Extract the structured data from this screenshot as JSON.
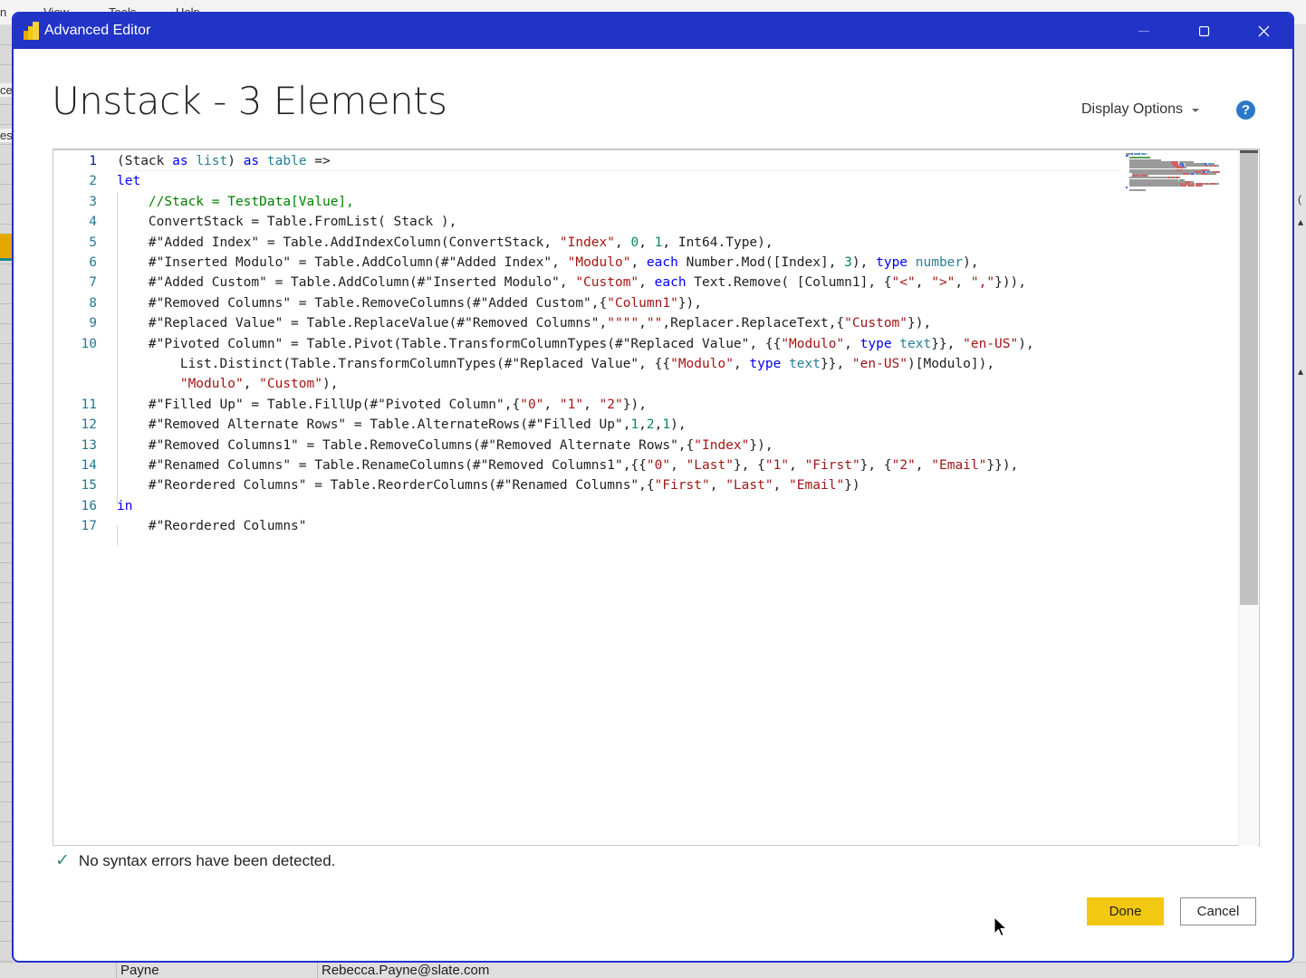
{
  "background_app": {
    "menu": [
      "n",
      "View",
      "Tools",
      "Help"
    ],
    "left_labels": [
      "ce",
      "es"
    ],
    "bottom_row": {
      "last_name": "Payne",
      "email": "Rebecca.Payne@slate.com"
    }
  },
  "window": {
    "title": "Advanced Editor",
    "app_icon": "power-bi-icon",
    "controls": {
      "minimize": "minimize-icon",
      "maximize": "maximize-icon",
      "close": "close-icon"
    }
  },
  "editor_header": {
    "query_name": "Unstack - 3 Elements",
    "display_options_label": "Display Options",
    "help_label": "?"
  },
  "colors": {
    "titlebar": "#2233c8",
    "done_button": "#f2c811",
    "keyword": "#0000ff",
    "type": "#267f99",
    "string": "#a31515",
    "number": "#098658",
    "comment": "#008000",
    "line_number": "#237893"
  },
  "code": {
    "lines": [
      {
        "n": "1",
        "tokens": [
          [
            "p",
            "(Stack "
          ],
          [
            "k",
            "as"
          ],
          [
            "p",
            " "
          ],
          [
            "t",
            "list"
          ],
          [
            "p",
            ") "
          ],
          [
            "k",
            "as"
          ],
          [
            "p",
            " "
          ],
          [
            "t",
            "table"
          ],
          [
            "p",
            " =>"
          ]
        ]
      },
      {
        "n": "2",
        "tokens": [
          [
            "k",
            "let"
          ]
        ]
      },
      {
        "n": "3",
        "tokens": [
          [
            "p",
            "    "
          ],
          [
            "c",
            "//Stack = TestData[Value],"
          ]
        ]
      },
      {
        "n": "4",
        "tokens": [
          [
            "p",
            "    ConvertStack = Table.FromList( Stack ),"
          ]
        ]
      },
      {
        "n": "5",
        "tokens": [
          [
            "p",
            "    #\"Added Index\" = Table.AddIndexColumn(ConvertStack, "
          ],
          [
            "s",
            "\"Index\""
          ],
          [
            "p",
            ", "
          ],
          [
            "d",
            "0"
          ],
          [
            "p",
            ", "
          ],
          [
            "d",
            "1"
          ],
          [
            "p",
            ", Int64.Type),"
          ]
        ]
      },
      {
        "n": "6",
        "tokens": [
          [
            "p",
            "    #\"Inserted Modulo\" = Table.AddColumn(#\"Added Index\", "
          ],
          [
            "s",
            "\"Modulo\""
          ],
          [
            "p",
            ", "
          ],
          [
            "k",
            "each"
          ],
          [
            "p",
            " Number.Mod([Index], "
          ],
          [
            "d",
            "3"
          ],
          [
            "p",
            "), "
          ],
          [
            "k",
            "type"
          ],
          [
            "p",
            " "
          ],
          [
            "t",
            "number"
          ],
          [
            "p",
            "),"
          ]
        ]
      },
      {
        "n": "7",
        "tokens": [
          [
            "p",
            "    #\"Added Custom\" = Table.AddColumn(#\"Inserted Modulo\", "
          ],
          [
            "s",
            "\"Custom\""
          ],
          [
            "p",
            ", "
          ],
          [
            "k",
            "each"
          ],
          [
            "p",
            " Text.Remove( [Column1], {"
          ],
          [
            "s",
            "\"<\""
          ],
          [
            "p",
            ", "
          ],
          [
            "s",
            "\">\""
          ],
          [
            "p",
            ", "
          ],
          [
            "s",
            "\",\""
          ],
          [
            "p",
            "})),"
          ]
        ]
      },
      {
        "n": "8",
        "tokens": [
          [
            "p",
            "    #\"Removed Columns\" = Table.RemoveColumns(#\"Added Custom\",{"
          ],
          [
            "s",
            "\"Column1\""
          ],
          [
            "p",
            "}),"
          ]
        ]
      },
      {
        "n": "9",
        "tokens": [
          [
            "p",
            "    #\"Replaced Value\" = Table.ReplaceValue(#\"Removed Columns\","
          ],
          [
            "s",
            "\"\"\"\""
          ],
          [
            "p",
            ","
          ],
          [
            "s",
            "\"\""
          ],
          [
            "p",
            ",Replacer.ReplaceText,{"
          ],
          [
            "s",
            "\"Custom\""
          ],
          [
            "p",
            "}),"
          ]
        ]
      },
      {
        "n": "10",
        "tokens": [
          [
            "p",
            "    #\"Pivoted Column\" = Table.Pivot(Table.TransformColumnTypes(#\"Replaced Value\", {{"
          ],
          [
            "s",
            "\"Modulo\""
          ],
          [
            "p",
            ", "
          ],
          [
            "k",
            "type"
          ],
          [
            "p",
            " "
          ],
          [
            "t",
            "text"
          ],
          [
            "p",
            "}}, "
          ],
          [
            "s",
            "\"en-US\""
          ],
          [
            "p",
            "),"
          ]
        ]
      },
      {
        "n": "",
        "tokens": [
          [
            "p",
            "        List.Distinct(Table.TransformColumnTypes(#\"Replaced Value\", {{"
          ],
          [
            "s",
            "\"Modulo\""
          ],
          [
            "p",
            ", "
          ],
          [
            "k",
            "type"
          ],
          [
            "p",
            " "
          ],
          [
            "t",
            "text"
          ],
          [
            "p",
            "}}, "
          ],
          [
            "s",
            "\"en-US\""
          ],
          [
            "p",
            ")[Modulo]),"
          ]
        ]
      },
      {
        "n": "",
        "tokens": [
          [
            "p",
            "        "
          ],
          [
            "s",
            "\"Modulo\""
          ],
          [
            "p",
            ", "
          ],
          [
            "s",
            "\"Custom\""
          ],
          [
            "p",
            "),"
          ]
        ]
      },
      {
        "n": "11",
        "tokens": [
          [
            "p",
            "    #\"Filled Up\" = Table.FillUp(#\"Pivoted Column\",{"
          ],
          [
            "s",
            "\"0\""
          ],
          [
            "p",
            ", "
          ],
          [
            "s",
            "\"1\""
          ],
          [
            "p",
            ", "
          ],
          [
            "s",
            "\"2\""
          ],
          [
            "p",
            "}),"
          ]
        ]
      },
      {
        "n": "12",
        "tokens": [
          [
            "p",
            "    #\"Removed Alternate Rows\" = Table.AlternateRows(#\"Filled Up\","
          ],
          [
            "d",
            "1"
          ],
          [
            "p",
            ","
          ],
          [
            "d",
            "2"
          ],
          [
            "p",
            ","
          ],
          [
            "d",
            "1"
          ],
          [
            "p",
            "),"
          ]
        ]
      },
      {
        "n": "13",
        "tokens": [
          [
            "p",
            "    #\"Removed Columns1\" = Table.RemoveColumns(#\"Removed Alternate Rows\",{"
          ],
          [
            "s",
            "\"Index\""
          ],
          [
            "p",
            "}),"
          ]
        ]
      },
      {
        "n": "14",
        "tokens": [
          [
            "p",
            "    #\"Renamed Columns\" = Table.RenameColumns(#\"Removed Columns1\",{{"
          ],
          [
            "s",
            "\"0\""
          ],
          [
            "p",
            ", "
          ],
          [
            "s",
            "\"Last\""
          ],
          [
            "p",
            "}, {"
          ],
          [
            "s",
            "\"1\""
          ],
          [
            "p",
            ", "
          ],
          [
            "s",
            "\"First\""
          ],
          [
            "p",
            "}, {"
          ],
          [
            "s",
            "\"2\""
          ],
          [
            "p",
            ", "
          ],
          [
            "s",
            "\"Email\""
          ],
          [
            "p",
            "}}),"
          ]
        ]
      },
      {
        "n": "15",
        "tokens": [
          [
            "p",
            "    #\"Reordered Columns\" = Table.ReorderColumns(#\"Renamed Columns\",{"
          ],
          [
            "s",
            "\"First\""
          ],
          [
            "p",
            ", "
          ],
          [
            "s",
            "\"Last\""
          ],
          [
            "p",
            ", "
          ],
          [
            "s",
            "\"Email\""
          ],
          [
            "p",
            "})"
          ]
        ]
      },
      {
        "n": "16",
        "tokens": [
          [
            "k",
            "in"
          ]
        ]
      },
      {
        "n": "17",
        "tokens": [
          [
            "p",
            "    #\"Reordered Columns\""
          ]
        ]
      }
    ],
    "active_line": "1"
  },
  "status": {
    "icon": "check-icon",
    "message": "No syntax errors have been detected."
  },
  "buttons": {
    "done": "Done",
    "cancel": "Cancel"
  }
}
